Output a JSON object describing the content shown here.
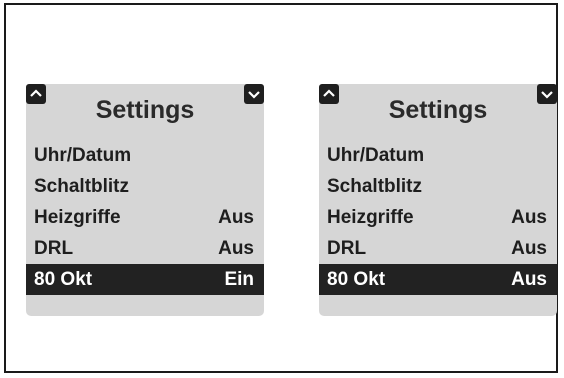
{
  "panels": [
    {
      "title": "Settings",
      "items": [
        {
          "label": "Uhr/Datum",
          "value": ""
        },
        {
          "label": "Schaltblitz",
          "value": ""
        },
        {
          "label": "Heizgriffe",
          "value": "Aus"
        },
        {
          "label": "DRL",
          "value": "Aus"
        },
        {
          "label": "80 Okt",
          "value": "Ein"
        }
      ]
    },
    {
      "title": "Settings",
      "items": [
        {
          "label": "Uhr/Datum",
          "value": ""
        },
        {
          "label": "Schaltblitz",
          "value": ""
        },
        {
          "label": "Heizgriffe",
          "value": "Aus"
        },
        {
          "label": "DRL",
          "value": "Aus"
        },
        {
          "label": "80 Okt",
          "value": "Aus"
        }
      ]
    }
  ],
  "icons": {
    "up": "chevron-up-icon",
    "down": "chevron-down-icon"
  }
}
